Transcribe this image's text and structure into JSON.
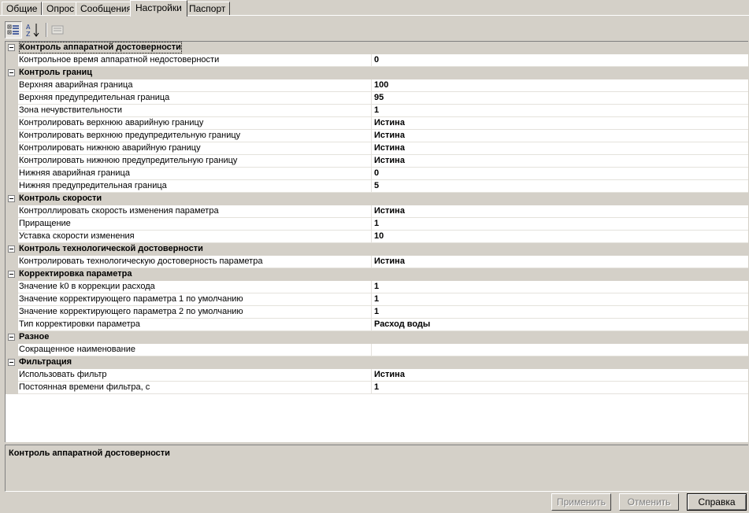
{
  "tabs": [
    {
      "label": "Общие"
    },
    {
      "label": "Опрос"
    },
    {
      "label": "Сообщения"
    },
    {
      "label": "Настройки"
    },
    {
      "label": "Паспорт"
    }
  ],
  "toolbar": {
    "categorized_icon": "categorized-view-icon",
    "alphabetical_icon": "sort-alphabetical-icon",
    "property_pages_icon": "property-pages-icon"
  },
  "grid": {
    "categories": [
      {
        "label": "Контроль аппаратной достоверности",
        "properties": [
          {
            "name": "Контрольное время аппаратной недостоверности",
            "value": "0"
          }
        ]
      },
      {
        "label": "Контроль границ",
        "properties": [
          {
            "name": "Верхняя аварийная граница",
            "value": "100"
          },
          {
            "name": "Верхняя предупредительная граница",
            "value": "95"
          },
          {
            "name": "Зона нечувствительности",
            "value": "1"
          },
          {
            "name": "Контролировать верхнюю аварийную границу",
            "value": "Истина"
          },
          {
            "name": "Контролировать верхнюю предупредительную границу",
            "value": "Истина"
          },
          {
            "name": "Контролировать нижнюю аварийную границу",
            "value": "Истина"
          },
          {
            "name": "Контролировать нижнюю предупредительную границу",
            "value": "Истина"
          },
          {
            "name": "Нижняя аварийная граница",
            "value": "0"
          },
          {
            "name": "Нижняя предупредительная граница",
            "value": "5"
          }
        ]
      },
      {
        "label": "Контроль скорости",
        "properties": [
          {
            "name": "Контроллировать скорость изменения параметра",
            "value": "Истина"
          },
          {
            "name": "Приращение",
            "value": "1"
          },
          {
            "name": "Уставка скорости изменения",
            "value": "10"
          }
        ]
      },
      {
        "label": "Контроль технологической достоверности",
        "properties": [
          {
            "name": "Контролировать технологическую достоверность параметра",
            "value": "Истина"
          }
        ]
      },
      {
        "label": "Корректировка параметра",
        "properties": [
          {
            "name": "Значение k0 в коррекции расхода",
            "value": "1"
          },
          {
            "name": "Значение корректирующего параметра 1 по умолчанию",
            "value": "1"
          },
          {
            "name": "Значение корректирующего параметра 2 по умолчанию",
            "value": "1"
          },
          {
            "name": "Тип корректировки параметра",
            "value": "Расход воды"
          }
        ]
      },
      {
        "label": "Разное",
        "properties": [
          {
            "name": "Сокращенное наименование",
            "value": ""
          }
        ]
      },
      {
        "label": "Фильтрация",
        "properties": [
          {
            "name": "Использовать фильтр",
            "value": "Истина"
          },
          {
            "name": "Постоянная времени фильтра, с",
            "value": "1"
          }
        ]
      }
    ]
  },
  "help": {
    "title": "Контроль аппаратной достоверности"
  },
  "buttons": {
    "apply": "Применить",
    "cancel": "Отменить",
    "help": "Справка"
  }
}
